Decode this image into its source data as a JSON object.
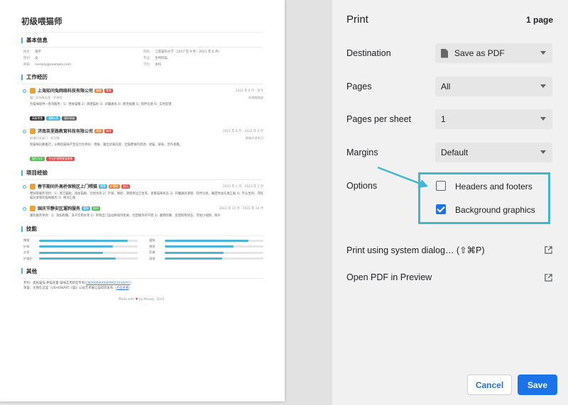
{
  "resume": {
    "name": "初级喂猫师",
    "basic": {
      "title": "基本信息",
      "fields": [
        {
          "k": "姓名:",
          "v": "貓宇"
        },
        {
          "k": "院校:",
          "v": "江南猫科大学（2017 年 9 月 - 2021 年 6 月）"
        },
        {
          "k": "性别:",
          "v": "女"
        },
        {
          "k": "专业:",
          "v": "生物制猫"
        },
        {
          "k": "邮箱:",
          "v": "noreply@example.com"
        },
        {
          "k": "学历:",
          "v": "本科"
        }
      ]
    },
    "work": {
      "title": "工作经历",
      "jobs": [
        {
          "company": "上海知问兔网络科技有限公司",
          "tags": [
            {
              "t": "猫粮",
              "c": "#e8843c"
            },
            {
              "t": "零食",
              "c": "#e04e4e"
            }
          ],
          "date": "2022 年 6 月 - 至今",
          "sub_left": "猫门支持事业部 · 铲屎官",
          "sub_right": "前端猫猫部",
          "desc": "为猫咪提供一系列服务：1）喂食猫粮 2）清理猫砂 3）开罐通风 4）梳毛按摩 5）陪伴玩耍 6）实时反馈",
          "chips": [
            {
              "t": "高级零食",
              "c": "#333"
            },
            {
              "t": "猫粮A类",
              "c": "#4ab5d8"
            },
            {
              "t": "猫砂高级",
              "c": "#666"
            }
          ]
        },
        {
          "company": "济南英里路教育科技有限公司",
          "tags": [
            {
              "t": "喂食",
              "c": "#e8843c"
            },
            {
              "t": "陪伴",
              "c": "#e04e4e"
            }
          ],
          "date": "2021 年 6 月 - 2022 年 6 月",
          "sub_left": "前端开发部门 · 实习猫",
          "sub_right": "前端开发实习",
          "desc": "陪猫咪玩要搬迁；以降低猫咪产生压力为目标：喂食、输出优质内容；社猫喂食的改进、试猫、研发、合作查看。",
          "chips": [
            {
              "t": "猫行为学",
              "c": "#5cb85c"
            },
            {
              "t": "专业护理喂食猫零食",
              "c": "#e04e4e"
            }
          ]
        }
      ]
    },
    "projects": {
      "title": "项目经验",
      "items": [
        {
          "name": "春节期间外高桥保税区上门喂猫",
          "tags": [
            {
              "t": "喂食",
              "c": "#4ab5d8"
            },
            {
              "t": "铲猫砂",
              "c": "#e8843c"
            },
            {
              "t": "陪玩",
              "c": "#e04e4e"
            }
          ],
          "date": "2023 年 1 月 - 2023 年 2 月",
          "desc": "喂饲等服务项目：1）清洁猫碗、添加猫粮、饮用水等 2）铲屎、换砂、清理周边卫生等、查看猫咪状态 3）开罐通风清理、陪伴玩耍，确定时会在群汇报 4）不认生的、可陪猫玩耍等的猫咪服务 5）情况汇报"
        },
        {
          "name": "国庆节静安区遛狗服务",
          "tags": [
            {
              "t": "遛狗",
              "c": "#4ab5d8"
            },
            {
              "t": "陪伴",
              "c": "#5cb85c"
            }
          ],
          "date": "2022 年 10 月 - 2022 年 10 月",
          "desc": "遛狗服务项目：1）添加狗粮、洗干饮用水等 2）带狗出门运动并保持距离、捡回服务的干而 3）遛狗陪聊、反馈狗狗状态、可拍小视频、照片"
        }
      ]
    },
    "skills": {
      "title": "技能",
      "items": [
        {
          "name": "撸猫",
          "level": 0.9
        },
        {
          "name": "遛狗",
          "level": 0.85
        },
        {
          "name": "铲屎",
          "level": 0.75
        },
        {
          "name": "喂鱼",
          "level": 0.7
        },
        {
          "name": "文案",
          "level": 0.65
        },
        {
          "name": "剪辑",
          "level": 0.6
        },
        {
          "name": "护猫护",
          "level": 0.78
        },
        {
          "name": "清理",
          "level": 0.58
        }
      ]
    },
    "other": {
      "title": "其他",
      "patent_prefix": "专利：奥拓猫猫·养猫装置·猫咪实用新型专利",
      "patent_link": "CN2000000000002103A0YC",
      "honor_prefix": "荣誉：文明在这里（USHOWART《猫》公益艺术展让猫得到发布",
      "honor_link": "点击查看"
    },
    "footer_prefix": "Made with",
    "footer_suffix": "by Meowy（Emi）"
  },
  "print": {
    "title": "Print",
    "page_count": "1 page",
    "destination": {
      "label": "Destination",
      "value": "Save as PDF"
    },
    "pages": {
      "label": "Pages",
      "value": "All"
    },
    "pages_per_sheet": {
      "label": "Pages per sheet",
      "value": "1"
    },
    "margins": {
      "label": "Margins",
      "value": "Default"
    },
    "options": {
      "label": "Options",
      "headers_footers": {
        "label": "Headers and footers",
        "checked": false
      },
      "background_graphics": {
        "label": "Background graphics",
        "checked": true
      }
    },
    "system_dialog": "Print using system dialog… (⇧⌘P)",
    "open_preview": "Open PDF in Preview",
    "cancel": "Cancel",
    "save": "Save"
  },
  "colors": {
    "accent": "#1a73e8",
    "highlight": "#3fb8cf",
    "resume_accent": "#4ab5d8"
  }
}
